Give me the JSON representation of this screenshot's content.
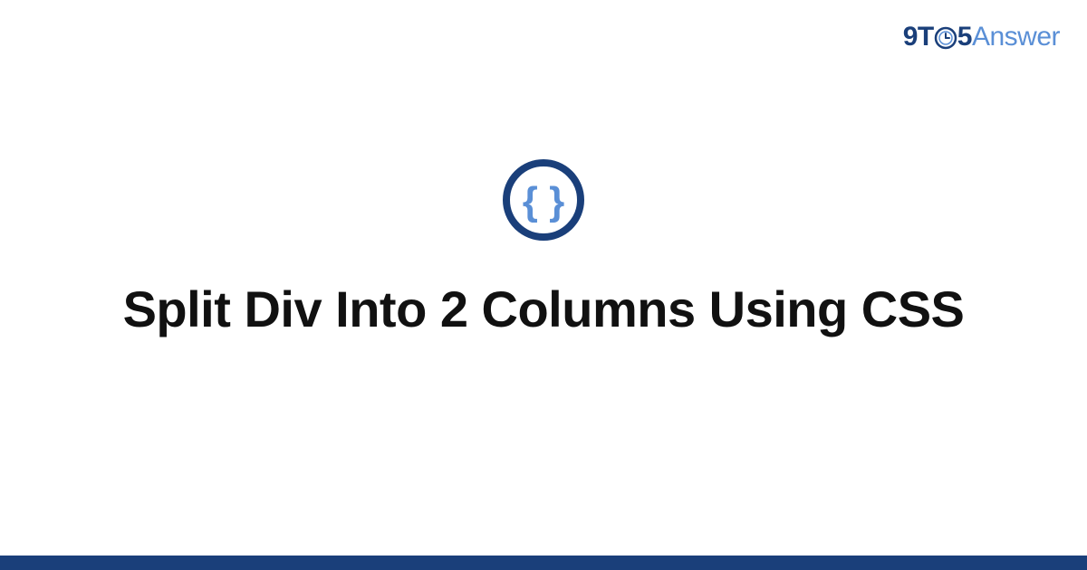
{
  "brand": {
    "part1": "9T",
    "part2": "5",
    "part3": "Answer"
  },
  "badge": {
    "icon_name": "code-braces-icon"
  },
  "page": {
    "title": "Split Div Into 2 Columns Using CSS"
  },
  "colors": {
    "brand_dark": "#1a3f7a",
    "brand_light": "#5a8fd6",
    "footer": "#1a3f7a"
  }
}
